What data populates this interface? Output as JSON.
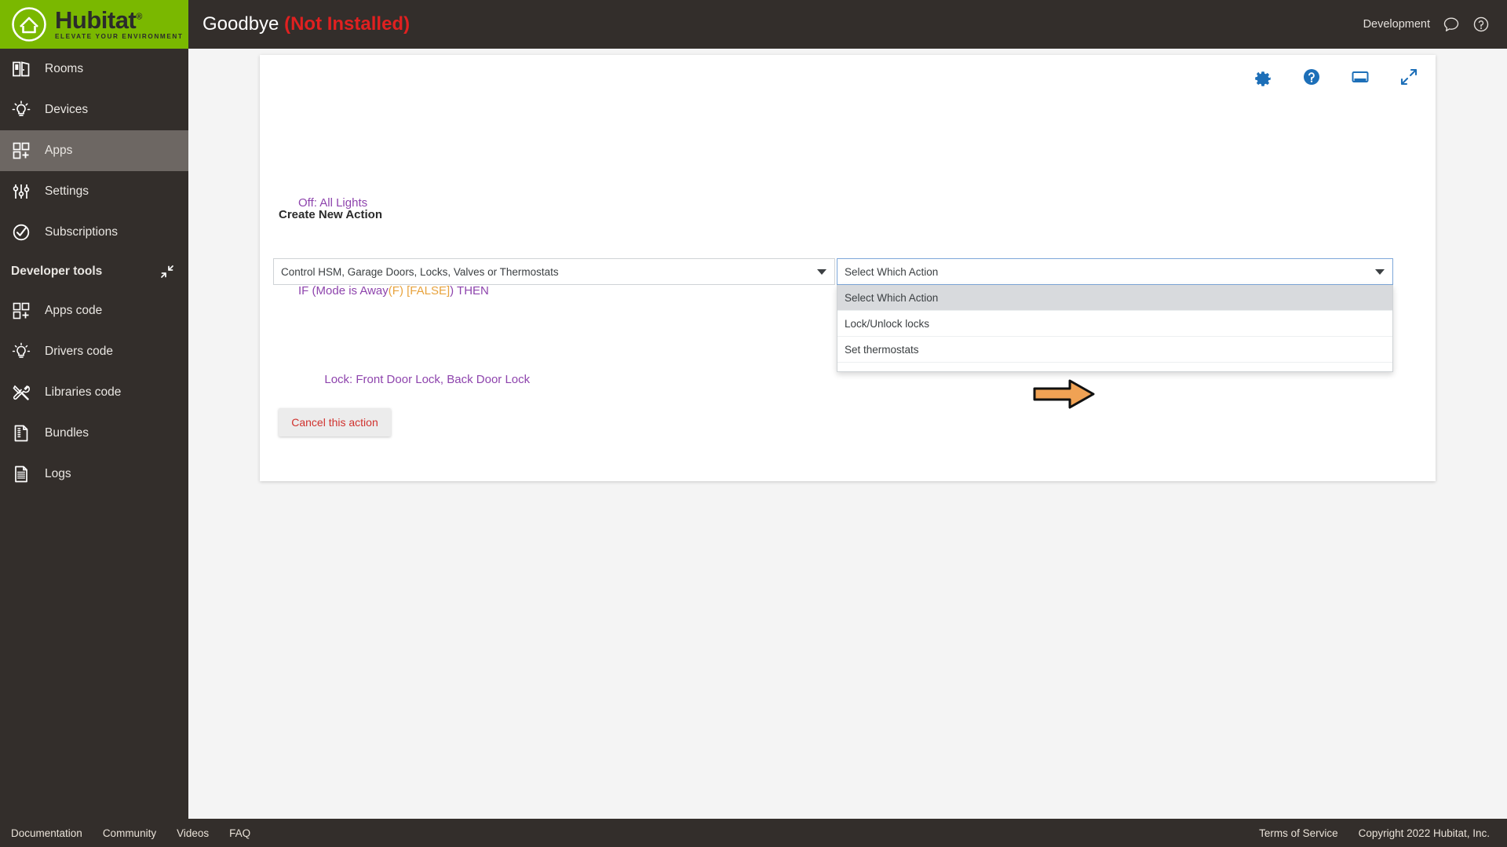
{
  "brand": {
    "name": "Hubitat",
    "registered": "®",
    "tagline": "ELEVATE YOUR ENVIRONMENT",
    "green": "#7ab800",
    "sidebar_bg": "#332e2b"
  },
  "sidebar": {
    "items": [
      {
        "label": "Rooms",
        "icon": "rooms-icon",
        "active": false
      },
      {
        "label": "Devices",
        "icon": "devices-icon",
        "active": false
      },
      {
        "label": "Apps",
        "icon": "apps-icon",
        "active": true
      },
      {
        "label": "Settings",
        "icon": "settings-icon",
        "active": false
      },
      {
        "label": "Subscriptions",
        "icon": "subscriptions-icon",
        "active": false
      }
    ],
    "developer_tools": {
      "label": "Developer tools",
      "collapse_icon": "collapse-icon",
      "items": [
        {
          "label": "Apps code",
          "icon": "apps-code-icon"
        },
        {
          "label": "Drivers code",
          "icon": "drivers-code-icon"
        },
        {
          "label": "Libraries code",
          "icon": "libraries-code-icon"
        },
        {
          "label": "Bundles",
          "icon": "bundles-icon"
        },
        {
          "label": "Logs",
          "icon": "logs-icon"
        }
      ]
    }
  },
  "topbar": {
    "title": "Goodbye",
    "status": "(Not Installed)",
    "status_color": "#e02020",
    "environment": "Development",
    "chat_icon": "chat-bubble-icon",
    "help_icon": "help-circle-icon"
  },
  "card": {
    "tools": [
      {
        "name": "gear-icon",
        "label": "Settings"
      },
      {
        "name": "help-circle-icon",
        "label": "Help"
      },
      {
        "name": "screen-icon",
        "label": "Display"
      },
      {
        "name": "expand-icon",
        "label": "Fullscreen"
      }
    ],
    "rule_lines": [
      {
        "prefix": "Off: All Lights",
        "highlight": "",
        "suffix": ""
      },
      {
        "prefix": "IF (Mode is Away",
        "highlight": "(F) [FALSE]",
        "suffix": ") THEN"
      },
      {
        "prefix": "        Lock: Front Door Lock, Back Door Lock",
        "highlight": "",
        "suffix": ""
      }
    ],
    "rule_text_color": "#8e44ad",
    "rule_highlight_color": "#e8a33d",
    "section_title": "Create New Action",
    "capability_select": {
      "value": "Control HSM, Garage Doors, Locks, Valves or Thermostats",
      "caret": "chevron-down-icon"
    },
    "action_select": {
      "value": "Select Which Action",
      "caret": "chevron-down-icon",
      "open": true,
      "options": [
        {
          "label": "Select Which Action",
          "selected": true
        },
        {
          "label": "Lock/Unlock locks",
          "selected": false
        },
        {
          "label": "Set thermostats",
          "selected": false
        }
      ]
    },
    "cancel_label": "Cancel this action",
    "cancel_color": "#d0322e",
    "annotation": {
      "name": "orange-arrow-annotation",
      "color": "#f0a254",
      "points_to": "Set thermostats"
    }
  },
  "footer": {
    "left": [
      "Documentation",
      "Community",
      "Videos",
      "FAQ"
    ],
    "right_link": "Terms of Service",
    "copyright": "Copyright 2022 Hubitat, Inc."
  }
}
